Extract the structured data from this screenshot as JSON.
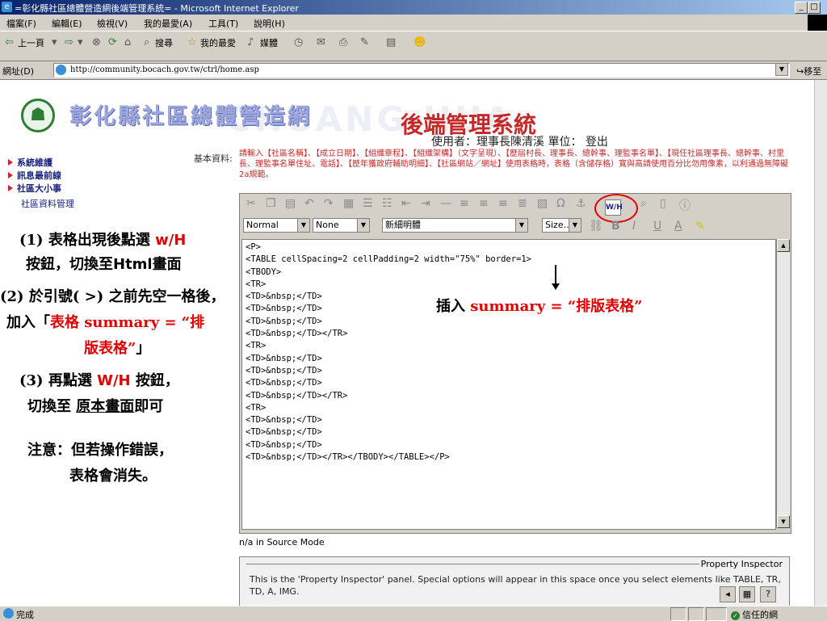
{
  "window": {
    "title": "=彰化縣社區總體營造網後端管理系統= - Microsoft Internet Explorer",
    "controls": [
      "_",
      "□"
    ]
  },
  "menu": [
    "檔案(F)",
    "編輯(E)",
    "檢視(V)",
    "我的最愛(A)",
    "工具(T)",
    "說明(H)"
  ],
  "toolbar": {
    "back": "上一頁",
    "search": "搜尋",
    "favorites": "我的最愛",
    "media": "媒體"
  },
  "address": {
    "label": "網址(D)",
    "url": "http://community.bocach.gov.tw/ctrl/home.asp",
    "go": "移至"
  },
  "header": {
    "site_title": "彰化縣社區總體營造網",
    "watermark": "CHUANG HUA",
    "backend_title": "後端管理系統",
    "user_info": "使用者：理事長陳清溪 單位： 登出"
  },
  "nav": {
    "items": [
      "系統維護",
      "訊息最前線",
      "社區大小事"
    ],
    "sub": "社區資料管理"
  },
  "form": {
    "basic_label": "基本資料:",
    "note": "請輸入【社區名稱】、【成立日期】、【組織章程】、【組織架構】（文字呈現）、【歷屆村長、理事長、總幹事、理監事名單】、【現任社區理事長、總幹事、村里長、理監事名單住址、電話】、【歷年獲政府輔助明細】、【社區網站／網址】使用表格時，表格（含儲存格）寬與高請使用百分比勿用像素，以利通過無障礙2a規範。"
  },
  "annotations": {
    "step1_a": "(1) 表格出現後點選 ",
    "step1_red": "w/H",
    "step1_b": "按鈕，切換至",
    "step1_bold": "Html",
    "step1_c": "畫面",
    "step2_a": "(2) 於引號( >) 之前先空一格後，",
    "step2_b": "加入「",
    "step2_red": "表格 summary = “排",
    "step2_red2": "版表格”",
    "step2_c": "」",
    "step3_a": "(3) 再點選 ",
    "step3_red": "W/H",
    "step3_b": " 按鈕，",
    "step3_c": "切換至 ",
    "step3_u": "原本畫面",
    "step3_d": "即可",
    "note_a": "注意：但若操作錯誤，",
    "note_b": "表格會消失。",
    "insert_a": "插入 ",
    "insert_red": "summary = “排版表格”"
  },
  "editor": {
    "style_select": "Normal",
    "format_select": "None",
    "font_select": "新細明體",
    "size_select": "Size..",
    "wh_button": "W/H",
    "code": "<P>\n<TABLE cellSpacing=2 cellPadding=2 width=\"75%\" border=1>\n<TBODY>\n<TR>\n<TD>&nbsp;</TD>\n<TD>&nbsp;</TD>\n<TD>&nbsp;</TD>\n<TD>&nbsp;</TD></TR>\n<TR>\n<TD>&nbsp;</TD>\n<TD>&nbsp;</TD>\n<TD>&nbsp;</TD>\n<TD>&nbsp;</TD></TR>\n<TR>\n<TD>&nbsp;</TD>\n<TD>&nbsp;</TD>\n<TD>&nbsp;</TD>\n<TD>&nbsp;</TD></TR></TBODY></TABLE></P>",
    "mode_line": "n/a in Source Mode"
  },
  "property_inspector": {
    "title": "Property Inspector",
    "text": "This is the 'Property Inspector' panel. Special options will appear in this space once you select elements like TABLE, TR, TD, A, IMG."
  },
  "status": {
    "text": "完成",
    "zone": "信任的網"
  }
}
